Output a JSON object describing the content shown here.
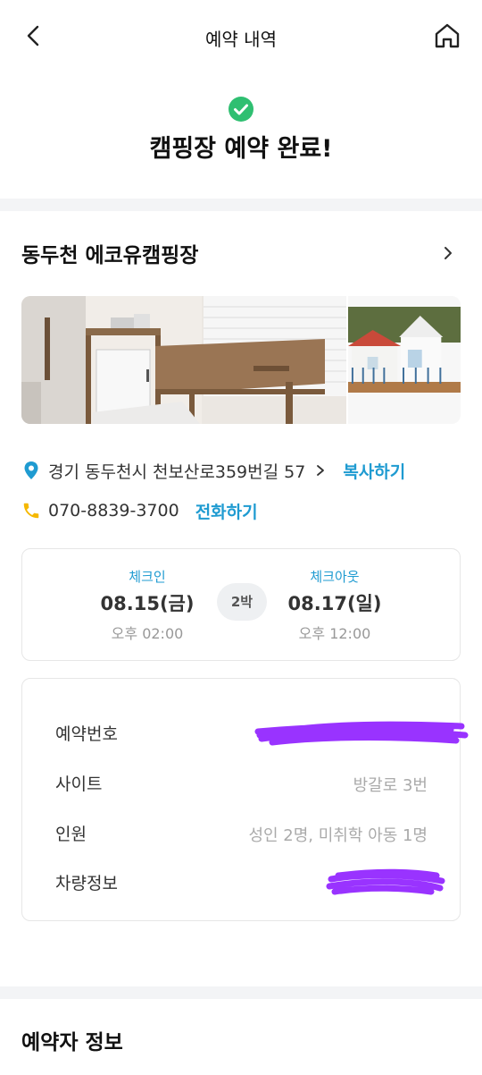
{
  "header": {
    "title": "예약 내역"
  },
  "confirmation": {
    "title": "캠핑장 예약 완료!"
  },
  "campsite": {
    "name": "동두천 에코유캠핑장",
    "address": "경기 동두천시 천보산로359번길 57",
    "copy_label": "복사하기",
    "phone": "070-8839-3700",
    "call_label": "전화하기"
  },
  "stay": {
    "checkin_label": "체크인",
    "checkin_date": "08.15(금)",
    "checkin_time": "오후 02:00",
    "nights": "2박",
    "checkout_label": "체크아웃",
    "checkout_date": "08.17(일)",
    "checkout_time": "오후 12:00"
  },
  "booking": {
    "reservation_no_label": "예약번호",
    "site_label": "사이트",
    "site_value": "방갈로 3번",
    "people_label": "인원",
    "people_value": "성인 2명, 미취학 아동 1명",
    "vehicle_label": "차량정보"
  },
  "booker_section": {
    "title": "예약자 정보"
  },
  "colors": {
    "accent": "#1f9bd1",
    "success": "#2fbf71",
    "phone_icon": "#f5b800",
    "redaction": "#9933ff"
  }
}
